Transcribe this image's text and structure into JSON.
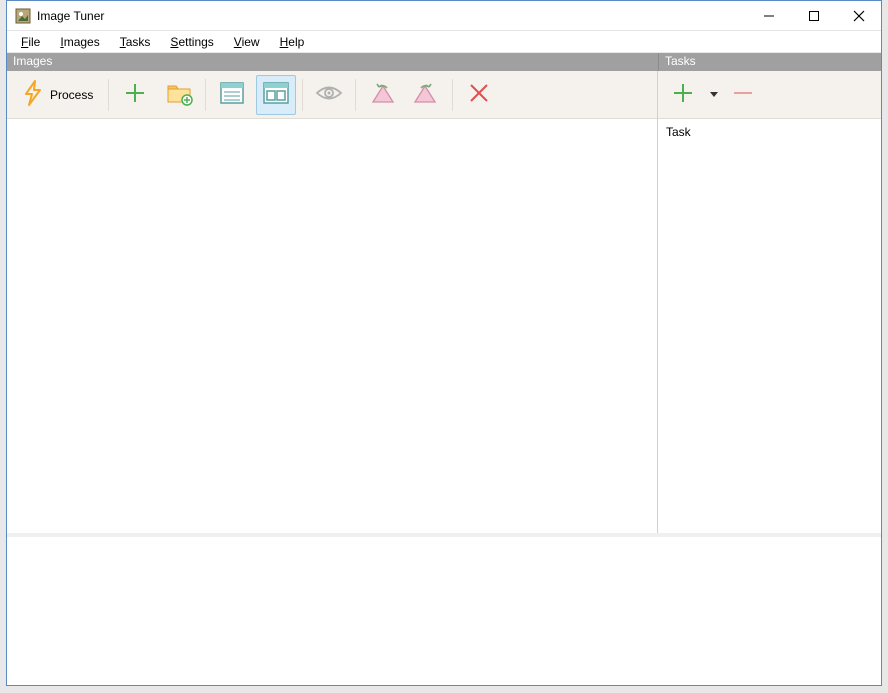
{
  "titlebar": {
    "title": "Image Tuner"
  },
  "menu": {
    "file": "File",
    "images": "Images",
    "tasks": "Tasks",
    "settings": "Settings",
    "view": "View",
    "help": "Help"
  },
  "panels": {
    "images_header": "Images",
    "tasks_header": "Tasks"
  },
  "toolbar": {
    "process_label": "Process"
  },
  "tasks": {
    "column_header": "Task"
  },
  "icons": {
    "process": "lightning-icon",
    "add": "plus-icon",
    "add_folder": "folder-plus-icon",
    "list_view": "list-view-icon",
    "thumb_view": "thumbnail-view-icon",
    "preview": "eye-icon",
    "rotate_left": "rotate-left-icon",
    "rotate_right": "rotate-right-icon",
    "delete": "x-icon",
    "add_task": "plus-icon",
    "remove_task": "minus-icon"
  },
  "colors": {
    "accent_orange": "#f5a623",
    "accent_green": "#4caf50",
    "accent_red": "#e05050",
    "panel_header_bg": "#a0a0a0",
    "toolbar_bg": "#f5f1ec",
    "tool_active_bg": "#d9ecf9",
    "tool_active_border": "#9ec9e2"
  }
}
